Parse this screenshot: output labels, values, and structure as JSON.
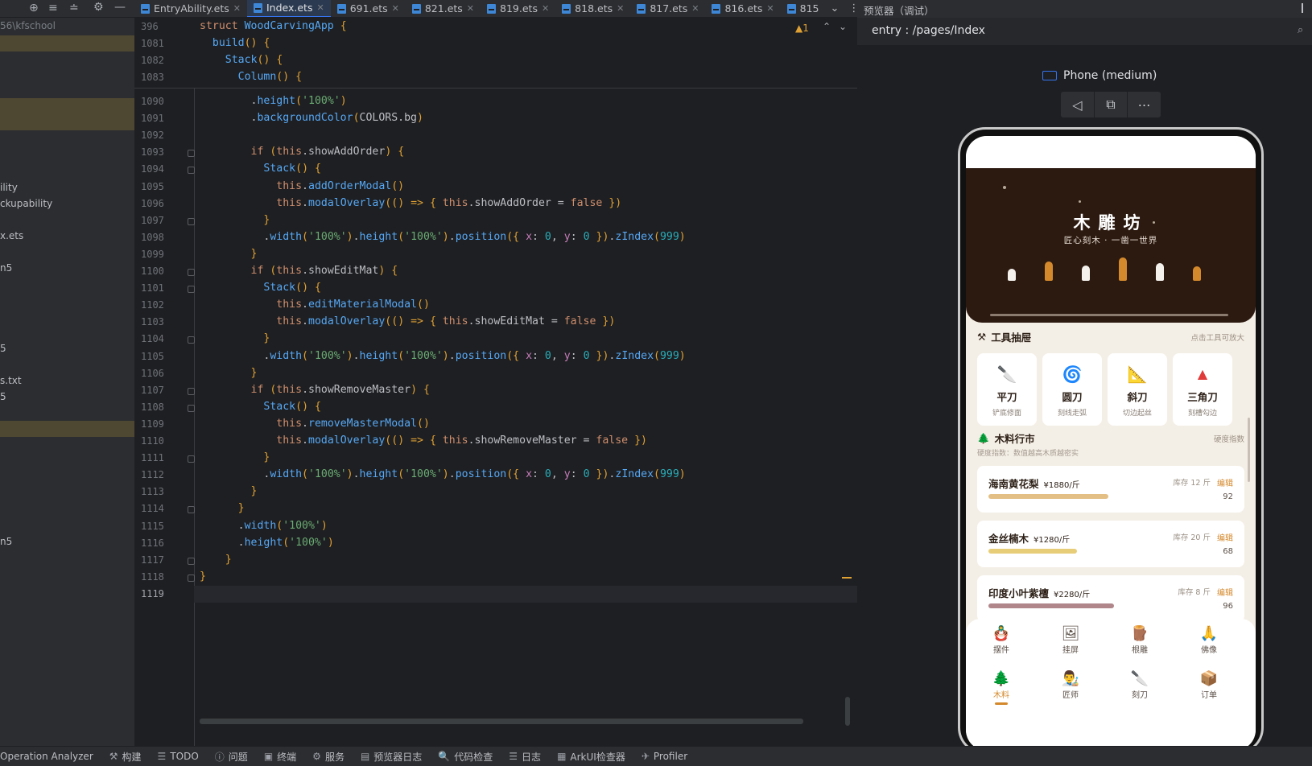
{
  "editor": {
    "tabs": [
      {
        "label": "EntryAbility.ets",
        "active": false
      },
      {
        "label": "Index.ets",
        "active": true
      },
      {
        "label": "691.ets",
        "active": false
      },
      {
        "label": "821.ets",
        "active": false
      },
      {
        "label": "819.ets",
        "active": false
      },
      {
        "label": "818.ets",
        "active": false
      },
      {
        "label": "817.ets",
        "active": false
      },
      {
        "label": "816.ets",
        "active": false
      },
      {
        "label": "815",
        "active": false
      }
    ],
    "warning_count": "▲1",
    "sticky_lines": [
      {
        "num": "396",
        "text": "struct WoodCarvingApp {"
      },
      {
        "num": "1081",
        "text": "  build() {"
      },
      {
        "num": "1082",
        "text": "    Stack() {"
      },
      {
        "num": "1083",
        "text": "      Column() {"
      }
    ],
    "lines": [
      {
        "num": "1090",
        "text": "        .height('100%')"
      },
      {
        "num": "1091",
        "text": "        .backgroundColor(COLORS.bg)"
      },
      {
        "num": "1092",
        "text": ""
      },
      {
        "num": "1093",
        "text": "        if (this.showAddOrder) {"
      },
      {
        "num": "1094",
        "text": "          Stack() {"
      },
      {
        "num": "1095",
        "text": "            this.addOrderModal()"
      },
      {
        "num": "1096",
        "text": "            this.modalOverlay(() => { this.showAddOrder = false })"
      },
      {
        "num": "1097",
        "text": "          }"
      },
      {
        "num": "1098",
        "text": "          .width('100%').height('100%').position({ x: 0, y: 0 }).zIndex(999)"
      },
      {
        "num": "1099",
        "text": "        }"
      },
      {
        "num": "1100",
        "text": "        if (this.showEditMat) {"
      },
      {
        "num": "1101",
        "text": "          Stack() {"
      },
      {
        "num": "1102",
        "text": "            this.editMaterialModal()"
      },
      {
        "num": "1103",
        "text": "            this.modalOverlay(() => { this.showEditMat = false })"
      },
      {
        "num": "1104",
        "text": "          }"
      },
      {
        "num": "1105",
        "text": "          .width('100%').height('100%').position({ x: 0, y: 0 }).zIndex(999)"
      },
      {
        "num": "1106",
        "text": "        }"
      },
      {
        "num": "1107",
        "text": "        if (this.showRemoveMaster) {"
      },
      {
        "num": "1108",
        "text": "          Stack() {"
      },
      {
        "num": "1109",
        "text": "            this.removeMasterModal()"
      },
      {
        "num": "1110",
        "text": "            this.modalOverlay(() => { this.showRemoveMaster = false })"
      },
      {
        "num": "1111",
        "text": "          }"
      },
      {
        "num": "1112",
        "text": "          .width('100%').height('100%').position({ x: 0, y: 0 }).zIndex(999)"
      },
      {
        "num": "1113",
        "text": "        }"
      },
      {
        "num": "1114",
        "text": "      }"
      },
      {
        "num": "1115",
        "text": "      .width('100%')"
      },
      {
        "num": "1116",
        "text": "      .height('100%')"
      },
      {
        "num": "1117",
        "text": "    }"
      },
      {
        "num": "1118",
        "text": "}"
      },
      {
        "num": "1119",
        "text": ""
      }
    ]
  },
  "project_panel": {
    "items": [
      "56\\kfschool",
      "ility",
      "ckupability",
      "x.ets",
      "n5",
      "5",
      "s.txt",
      "5",
      "n5"
    ]
  },
  "preview": {
    "header": "预览器（调试）",
    "route": "entry : /pages/Index",
    "device": "Phone (medium)",
    "app": {
      "title": "木雕坊",
      "subtitle": "匠心刻木 · 一凿一世界",
      "tools_section": {
        "title": "工具抽屉",
        "hint": "点击工具可放大"
      },
      "tools": [
        {
          "name": "平刀",
          "desc": "铲底修面"
        },
        {
          "name": "圆刀",
          "desc": "刻线走弧"
        },
        {
          "name": "斜刀",
          "desc": "切边起丝"
        },
        {
          "name": "三角刀",
          "desc": "刻槽勾边"
        }
      ],
      "wood_section": {
        "title": "木料行市",
        "hint": "硬度指数",
        "sub": "硬度指数：数值越高木质越密实"
      },
      "woods": [
        {
          "name": "海南黄花梨",
          "price": "¥1880/斤",
          "stock": "库存 12 斤",
          "edit": "编辑",
          "score": "92",
          "hardness": 0.92,
          "color": "#e3bf86"
        },
        {
          "name": "金丝楠木",
          "price": "¥1280/斤",
          "stock": "库存 20 斤",
          "edit": "编辑",
          "score": "68",
          "hardness": 0.68,
          "color": "#e8cd78"
        },
        {
          "name": "印度小叶紫檀",
          "price": "¥2280/斤",
          "stock": "库存 8 斤",
          "edit": "编辑",
          "score": "96",
          "hardness": 0.96,
          "color": "#b0868a"
        }
      ],
      "nav_row1": [
        {
          "label": "摆件",
          "icon": "🪆"
        },
        {
          "label": "挂屏",
          "icon": "🖼"
        },
        {
          "label": "根雕",
          "icon": "🪵"
        },
        {
          "label": "佛像",
          "icon": "🙏"
        }
      ],
      "nav_row2": [
        {
          "label": "木料",
          "icon": "🌲",
          "active": true
        },
        {
          "label": "匠师",
          "icon": "👨‍🎨",
          "active": false
        },
        {
          "label": "刻刀",
          "icon": "🔪",
          "active": false
        },
        {
          "label": "订单",
          "icon": "📦",
          "active": false
        }
      ]
    }
  },
  "bottom_bar": [
    {
      "label": "Operation Analyzer",
      "icon": ""
    },
    {
      "label": "构建",
      "icon": "⚒"
    },
    {
      "label": "TODO",
      "icon": "☰"
    },
    {
      "label": "问题",
      "icon": "ⓘ"
    },
    {
      "label": "终端",
      "icon": "▣"
    },
    {
      "label": "服务",
      "icon": "⚙"
    },
    {
      "label": "预览器日志",
      "icon": "▤"
    },
    {
      "label": "代码检查",
      "icon": "🔍"
    },
    {
      "label": "日志",
      "icon": "☰"
    },
    {
      "label": "ArkUI检查器",
      "icon": "▦"
    },
    {
      "label": "Profiler",
      "icon": "✈"
    }
  ]
}
